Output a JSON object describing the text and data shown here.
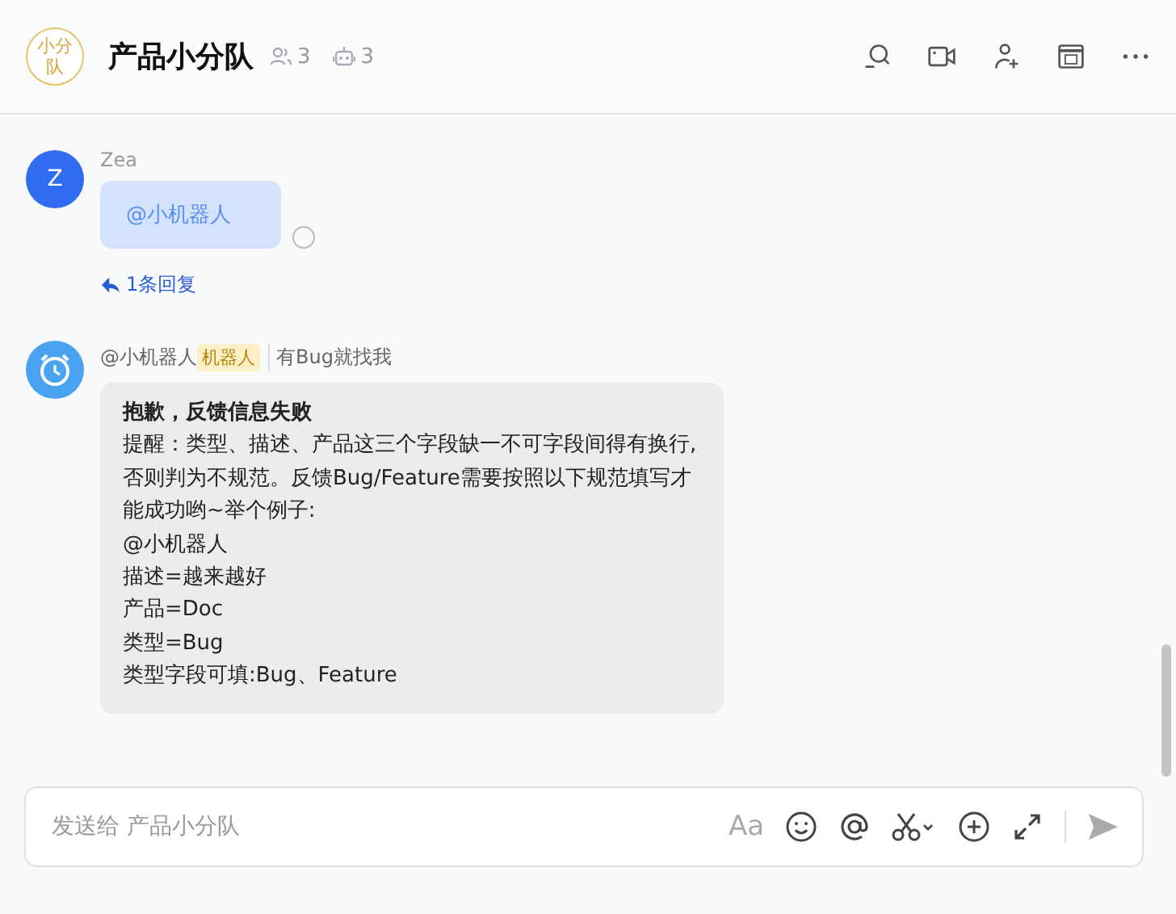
{
  "header": {
    "avatar_text": "小分队",
    "title": "产品小分队",
    "member_count": "3",
    "bot_count": "3"
  },
  "messages": [
    {
      "kind": "user",
      "avatar": "Z",
      "sender": "Zea",
      "mention": "@小机器人",
      "status_pending": true,
      "reply_count": "1条回复"
    },
    {
      "kind": "bot",
      "sender": "@小机器人",
      "tag": "机器人",
      "signature": "有Bug就找我",
      "title": "抱歉，反馈信息失败",
      "lines": [
        "提醒：类型、描述、产品这三个字段缺一不可字段间得有换行,否则判为不规范。反馈Bug/Feature需要按照以下规范填写才能成功哟~举个例子:",
        "@小机器人",
        "描述=越来越好",
        "产品=Doc",
        "类型=Bug",
        "类型字段可填:Bug、Feature"
      ]
    }
  ],
  "composer": {
    "placeholder": "发送给 产品小分队",
    "format_label": "Aa"
  }
}
